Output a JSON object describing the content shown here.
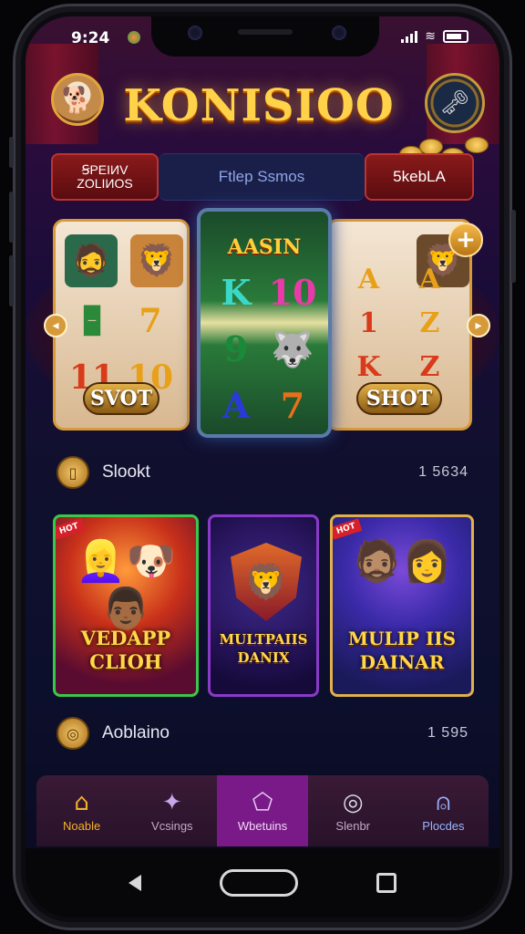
{
  "status_bar": {
    "time": "9:24"
  },
  "header": {
    "logo_text": "KONISIOO"
  },
  "top_tabs": {
    "left_label_line1": "ꞨPEIИV",
    "left_label_line2": "ZOLIИOS",
    "search_placeholder": "Ftlep Ssmos",
    "right_label": "5kebLA"
  },
  "carousel": {
    "left_card": {
      "banner": "SVOT",
      "symbols": [
        "🁢",
        "7",
        "11",
        "10"
      ]
    },
    "center_card": {
      "title": "AASIN",
      "symbols": [
        "K",
        "10",
        "9",
        "🐺",
        "A",
        "7"
      ]
    },
    "right_card": {
      "banner": "SHOT",
      "symbols": [
        "A",
        "A",
        "1",
        "Z",
        "K",
        "Z"
      ]
    },
    "add_button": "+"
  },
  "section_1": {
    "label": "Slookt",
    "count": "1 5634"
  },
  "games": [
    {
      "title_line1": "VEDAPP",
      "title_line2": "CLIOH",
      "ribbon": "HOT"
    },
    {
      "title_line1": "MULTPAIIS",
      "title_line2": "DANIX"
    },
    {
      "title_line1": "MULIP IIS",
      "title_line2": "DAINAR",
      "ribbon": "HOT"
    }
  ],
  "section_2": {
    "label": "Aoblaino",
    "count": "1 595"
  },
  "bottom_nav": [
    {
      "label": "Noable",
      "icon": "home-icon"
    },
    {
      "label": "Vcsings",
      "icon": "star-icon"
    },
    {
      "label": "Wbetuins",
      "icon": "diamond-icon",
      "active": true
    },
    {
      "label": "Slenbr",
      "icon": "chat-icon"
    },
    {
      "label": "Plocdes",
      "icon": "profile-icon"
    }
  ],
  "colors": {
    "accent_gold": "#ffd24a",
    "nav_active": "#7a1a88",
    "background": "#10102e"
  }
}
